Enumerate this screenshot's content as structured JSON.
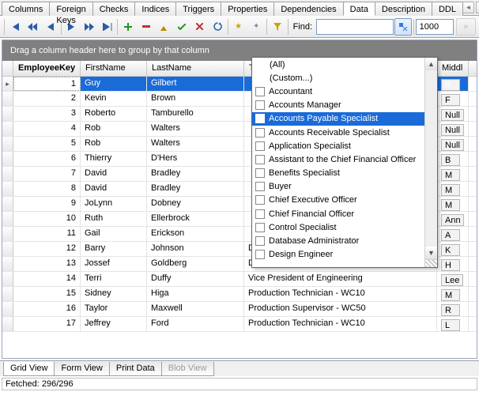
{
  "topTabs": {
    "items": [
      "Columns",
      "Foreign Keys",
      "Checks",
      "Indices",
      "Triggers",
      "Properties",
      "Dependencies",
      "Data",
      "Description",
      "DDL"
    ],
    "activeIndex": 7
  },
  "toolbar": {
    "findLabel": "Find:",
    "findValue": "",
    "limitValue": "1000"
  },
  "groupBar": "Drag a column header here to group by that column",
  "columns": {
    "key": "EmployeeKey",
    "first": "FirstName",
    "last": "LastName",
    "title": "Title",
    "middle": "Middl"
  },
  "rows": [
    {
      "k": "1",
      "f": "Guy",
      "l": "Gilbert",
      "t": "",
      "m": "R",
      "sel": true,
      "ind": "▸"
    },
    {
      "k": "2",
      "f": "Kevin",
      "l": "Brown",
      "t": "",
      "m": "F"
    },
    {
      "k": "3",
      "f": "Roberto",
      "l": "Tamburello",
      "t": "",
      "m": "Null"
    },
    {
      "k": "4",
      "f": "Rob",
      "l": "Walters",
      "t": "",
      "m": "Null"
    },
    {
      "k": "5",
      "f": "Rob",
      "l": "Walters",
      "t": "",
      "m": "Null"
    },
    {
      "k": "6",
      "f": "Thierry",
      "l": "D'Hers",
      "t": "",
      "m": "B"
    },
    {
      "k": "7",
      "f": "David",
      "l": "Bradley",
      "t": "",
      "m": "M"
    },
    {
      "k": "8",
      "f": "David",
      "l": "Bradley",
      "t": "",
      "m": "M"
    },
    {
      "k": "9",
      "f": "JoLynn",
      "l": "Dobney",
      "t": "",
      "m": "M"
    },
    {
      "k": "10",
      "f": "Ruth",
      "l": "Ellerbrock",
      "t": "",
      "m": "Ann"
    },
    {
      "k": "11",
      "f": "Gail",
      "l": "Erickson",
      "t": "",
      "m": "A"
    },
    {
      "k": "12",
      "f": "Barry",
      "l": "Johnson",
      "t": "Database Administrator",
      "m": "K"
    },
    {
      "k": "13",
      "f": "Jossef",
      "l": "Goldberg",
      "t": "Design Engineer",
      "m": "H"
    },
    {
      "k": "14",
      "f": "Terri",
      "l": "Duffy",
      "t": "Vice President of Engineering",
      "m": "Lee"
    },
    {
      "k": "15",
      "f": "Sidney",
      "l": "Higa",
      "t": "Production Technician - WC10",
      "m": "M"
    },
    {
      "k": "16",
      "f": "Taylor",
      "l": "Maxwell",
      "t": "Production Supervisor - WC50",
      "m": "R"
    },
    {
      "k": "17",
      "f": "Jeffrey",
      "l": "Ford",
      "t": "Production Technician - WC10",
      "m": "L"
    }
  ],
  "filterDropdown": {
    "special": [
      "(All)",
      "(Custom...)"
    ],
    "items": [
      "Accountant",
      "Accounts Manager",
      "Accounts Payable Specialist",
      "Accounts Receivable Specialist",
      "Application Specialist",
      "Assistant to the Chief Financial Officer",
      "Benefits Specialist",
      "Buyer",
      "Chief Executive Officer",
      "Chief Financial Officer",
      "Control Specialist",
      "Database Administrator",
      "Design Engineer"
    ],
    "highlightIndex": 2
  },
  "bottomTabs": {
    "items": [
      "Grid View",
      "Form View",
      "Print Data",
      "Blob View"
    ],
    "activeIndex": 0,
    "disabledIndex": 3
  },
  "status": "Fetched: 296/296"
}
